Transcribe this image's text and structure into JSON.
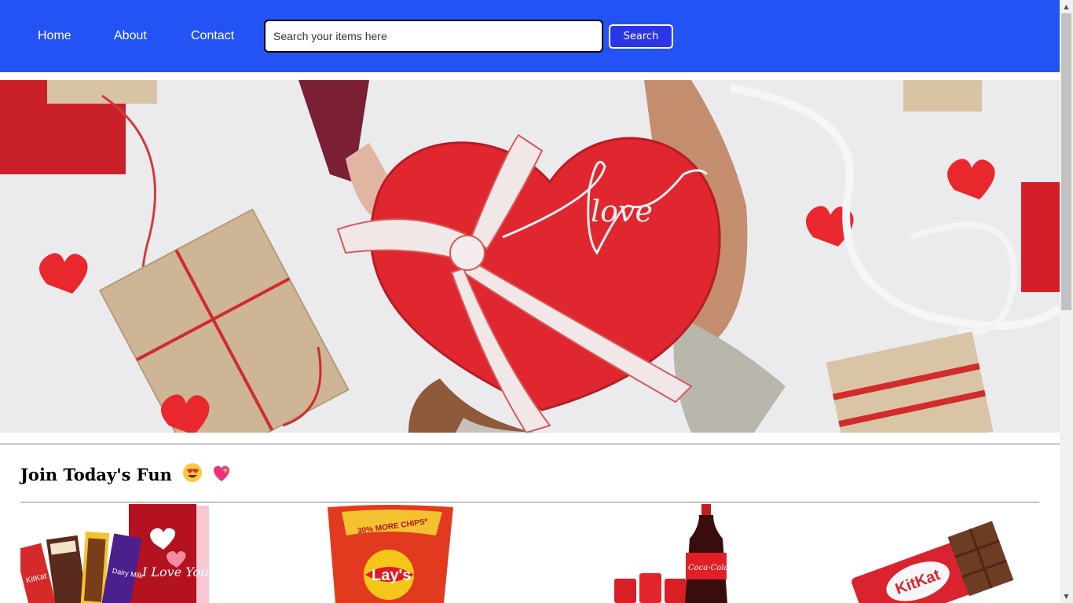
{
  "nav": {
    "links": [
      "Home",
      "About",
      "Contact"
    ],
    "search": {
      "placeholder": "Search your items here",
      "value": "",
      "button_label": "Search"
    }
  },
  "hero": {
    "image": "valentine-heart-gift-hero",
    "overlay_text": "love"
  },
  "section": {
    "title": "Join Today's Fun",
    "emojis": [
      "heart-eyes-emoji",
      "sparkling-heart-emoji"
    ]
  },
  "products": [
    {
      "name": "chocolate-gift-pack",
      "label_text": "I Love You"
    },
    {
      "name": "lays-chips",
      "label_text": "Lay's",
      "badge_text": "30% MORE CHIPS*"
    },
    {
      "name": "coca-cola-pack",
      "label_text": "Coca-Cola"
    },
    {
      "name": "kitkat-bar",
      "label_text": "KitKat"
    }
  ],
  "colors": {
    "navbar": "#2353f5",
    "search_button": "#2a36e6",
    "accent_red": "#e8282d"
  }
}
